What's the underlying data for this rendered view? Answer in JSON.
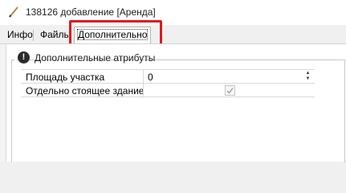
{
  "window": {
    "title": "138126 добавление [Аренда]",
    "icon": "pencil-icon"
  },
  "tabs": [
    {
      "label": "Инфо",
      "active": false
    },
    {
      "label": "Файлы",
      "active": false
    },
    {
      "label": "Дополнительно",
      "active": true
    }
  ],
  "highlight_color": "#e0191c",
  "group": {
    "title": "Дополнительные атрибуты",
    "icon": "exclamation-icon"
  },
  "attributes": [
    {
      "label": "Площадь участка",
      "value": "0",
      "control": "spin-edit"
    },
    {
      "label": "Отдельно стоящее здание",
      "value": "",
      "control": "checkbox",
      "checked": true
    }
  ]
}
